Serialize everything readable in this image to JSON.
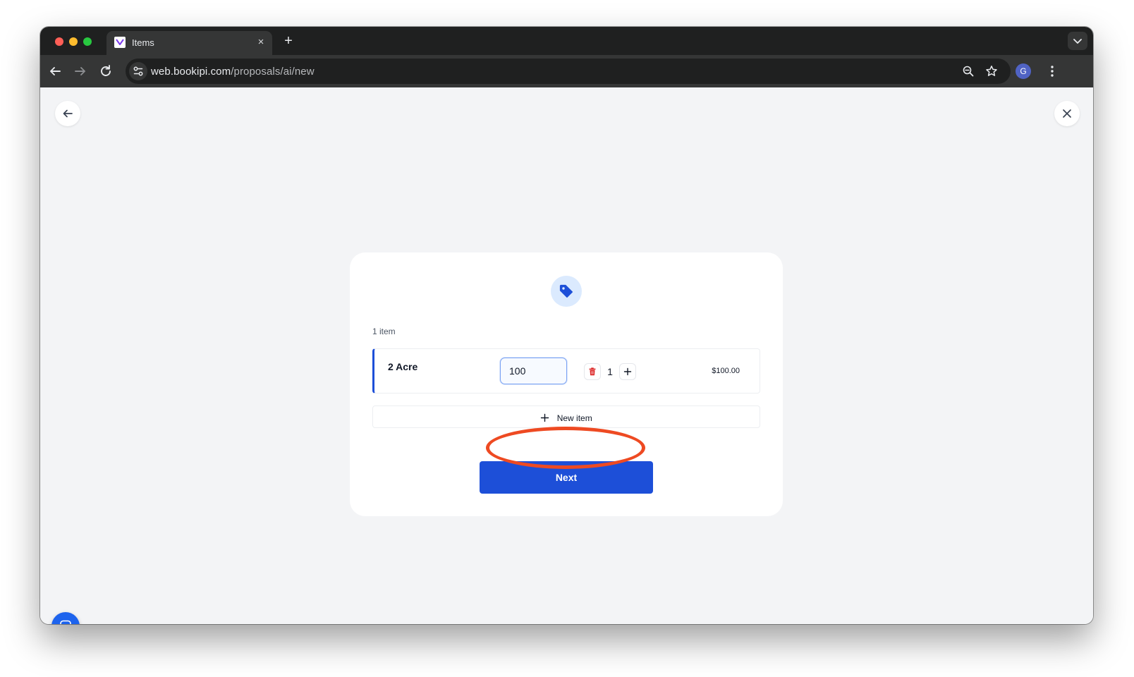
{
  "browser": {
    "tab_title": "Items",
    "tab_close_glyph": "×",
    "new_tab_glyph": "+",
    "url_host": "web.bookipi.com",
    "url_path": "/proposals/ai/new",
    "profile_initial": "G"
  },
  "items": {
    "count_label": "1 item",
    "rows": [
      {
        "name": "2 Acre",
        "price": "100",
        "quantity": "1",
        "total": "$100.00"
      }
    ],
    "new_item_label": "New item"
  },
  "actions": {
    "next_label": "Next"
  },
  "colors": {
    "primary": "#1d4fd8",
    "accent_light": "#dbeafe",
    "delete_red": "#dc2626",
    "highlight": "#ee4a22"
  },
  "icons": {
    "header": "tag-icon",
    "back": "arrow-left-icon",
    "close": "close-icon",
    "delete": "trash-icon",
    "increment": "plus-icon",
    "chat": "chat-icon"
  }
}
